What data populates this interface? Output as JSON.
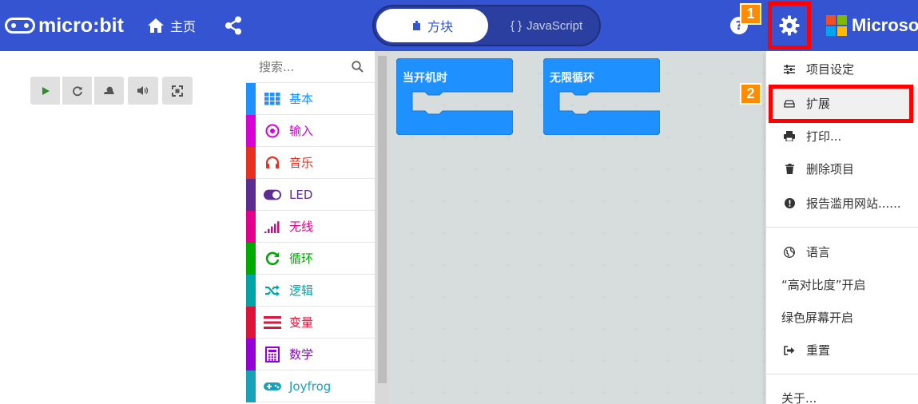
{
  "header": {
    "logo_text": "micro:bit",
    "home_label": "主页",
    "mode_blocks": "方块",
    "mode_js": "JavaScript",
    "mode_js_prefix": "{ }",
    "help_glyph": "?",
    "brand_text": "Microsoft",
    "brand_colors": [
      "#f25022",
      "#7fba00",
      "#00a4ef",
      "#ffb900"
    ],
    "bg_color": "#3454d1"
  },
  "annotations": {
    "step1": "1",
    "step2": "2",
    "highlight_color": "#ff0000",
    "badge_color": "#ff8c00"
  },
  "simulator": {
    "tools": [
      "play-icon",
      "restart-icon",
      "slowmo-icon",
      "mute-icon",
      "fullscreen-icon"
    ]
  },
  "toolbox": {
    "search_placeholder": "搜索...",
    "categories": [
      {
        "label": "基本",
        "color": "#1e90ff",
        "icon": "grid-icon"
      },
      {
        "label": "输入",
        "color": "#d400d4",
        "icon": "target-icon"
      },
      {
        "label": "音乐",
        "color": "#e63022",
        "icon": "headphones-icon"
      },
      {
        "label": "LED",
        "color": "#5c2d91",
        "icon": "toggle-icon"
      },
      {
        "label": "无线",
        "color": "#e3008c",
        "icon": "signal-icon"
      },
      {
        "label": "循环",
        "color": "#00aa00",
        "icon": "refresh-icon"
      },
      {
        "label": "逻辑",
        "color": "#00a4a6",
        "icon": "shuffle-icon"
      },
      {
        "label": "变量",
        "color": "#dc143c",
        "icon": "list-icon"
      },
      {
        "label": "数学",
        "color": "#9400d3",
        "icon": "calculator-icon"
      },
      {
        "label": "Joyfrog",
        "color": "#17a2b8",
        "icon": "gamepad-icon"
      }
    ]
  },
  "workspace": {
    "blocks": [
      {
        "label": "当开机时",
        "color": "#1e90ff"
      },
      {
        "label": "无限循环",
        "color": "#1e90ff"
      }
    ]
  },
  "menu": {
    "items": [
      {
        "label": "项目设定",
        "icon": "sliders-icon"
      },
      {
        "label": "扩展",
        "icon": "drive-icon"
      },
      {
        "label": "打印...",
        "icon": "print-icon"
      },
      {
        "label": "删除项目",
        "icon": "trash-icon"
      },
      {
        "label": "报告滥用网站......",
        "icon": "alert-icon"
      },
      {
        "label": "语言",
        "icon": "globe-icon"
      },
      {
        "label": "“高对比度”开启",
        "icon": ""
      },
      {
        "label": "绿色屏幕开启",
        "icon": ""
      },
      {
        "label": "重置",
        "icon": "signout-icon"
      },
      {
        "label": "关于...",
        "icon": ""
      }
    ]
  }
}
